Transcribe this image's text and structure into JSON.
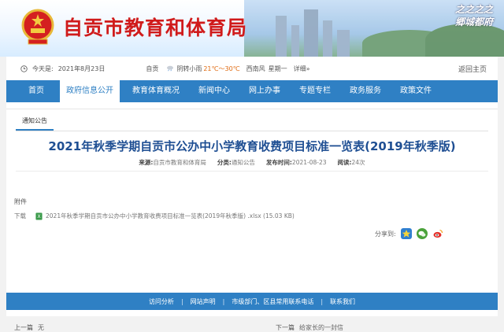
{
  "header": {
    "site_title": "自贡市教育和体育局",
    "calligraphy_line1": "之之之之",
    "calligraphy_line2": "郷城都府"
  },
  "infobar": {
    "today_label": "今天是:",
    "date": "2021年8月23日",
    "city": "自贡",
    "weather": "阴转小雨",
    "temp": "21℃～30℃",
    "wind": "西南风",
    "weekday": "星期一",
    "detail_link": "详细»",
    "back_link": "返回主页"
  },
  "nav": {
    "items": [
      {
        "label": "首页"
      },
      {
        "label": "政府信息公开"
      },
      {
        "label": "教育体育概况"
      },
      {
        "label": "新闻中心"
      },
      {
        "label": "网上办事"
      },
      {
        "label": "专题专栏"
      },
      {
        "label": "政务服务"
      },
      {
        "label": "政策文件"
      }
    ],
    "active_index": 1
  },
  "article": {
    "tab_label": "通知公告",
    "title": "2021年秋季学期自贡市公办中小学教育收费项目标准一览表(2019年秋季版)",
    "meta": {
      "source_label": "来源:",
      "source": "自贡市教育和体育局",
      "category_label": "分类:",
      "category": "通知公告",
      "date_label": "发布时间:",
      "date": "2021-08-23",
      "views_label": "阅读:",
      "views": "24次"
    },
    "attachment_label": "附件",
    "download_label": "下载",
    "attachment_file": "2021年秋季学期自贡市公办中小学教育收费项目标准一览表(2019年秋季版) .xlsx (15.03 KB)",
    "share_label": "分享到:",
    "prev_label": "上一篇",
    "prev_value": "无",
    "next_label": "下一篇",
    "next_value": "给家长的一封信"
  },
  "footer": {
    "links": [
      "访问分析",
      "网站声明",
      "市级部门、区县常用联系电话",
      "联系我们"
    ]
  },
  "colors": {
    "nav_blue": "#2f80c4",
    "title_red": "#d01b1b",
    "article_title_blue": "#1f4f93"
  }
}
